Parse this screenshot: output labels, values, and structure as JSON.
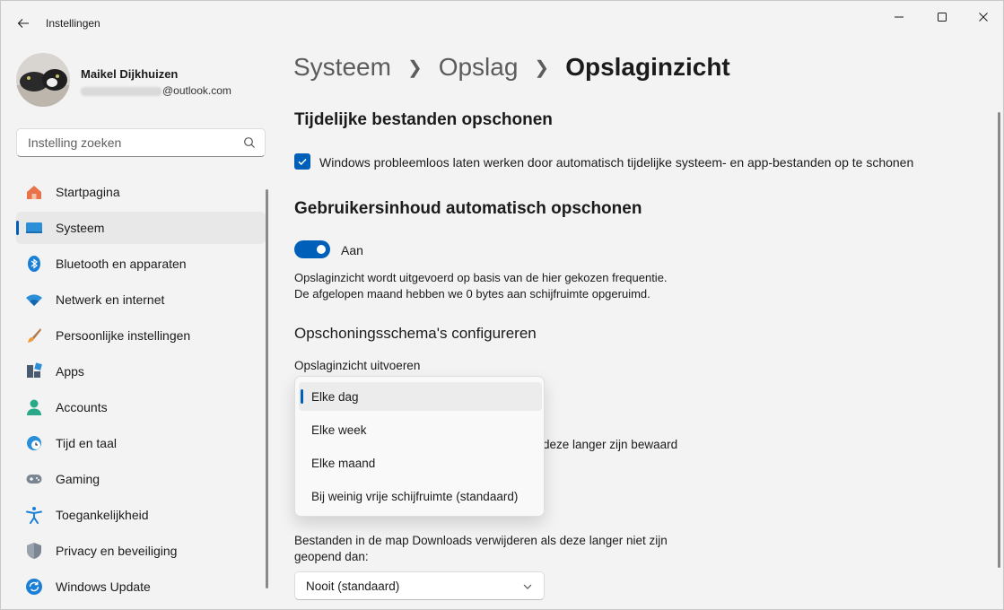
{
  "window": {
    "title": "Instellingen"
  },
  "user": {
    "name": "Maikel Dijkhuizen",
    "email_domain": "@outlook.com"
  },
  "search": {
    "placeholder": "Instelling zoeken"
  },
  "nav": {
    "items": [
      {
        "label": "Startpagina"
      },
      {
        "label": "Systeem"
      },
      {
        "label": "Bluetooth en apparaten"
      },
      {
        "label": "Netwerk en internet"
      },
      {
        "label": "Persoonlijke instellingen"
      },
      {
        "label": "Apps"
      },
      {
        "label": "Accounts"
      },
      {
        "label": "Tijd en taal"
      },
      {
        "label": "Gaming"
      },
      {
        "label": "Toegankelijkheid"
      },
      {
        "label": "Privacy en beveiliging"
      },
      {
        "label": "Windows Update"
      }
    ],
    "active": "Systeem"
  },
  "breadcrumb": {
    "level1": "Systeem",
    "level2": "Opslag",
    "current": "Opslaginzicht"
  },
  "temp_files": {
    "heading": "Tijdelijke bestanden opschonen",
    "checkbox_label": "Windows probleemloos laten werken door automatisch tijdelijke systeem- en app-bestanden op te schonen",
    "checked": true
  },
  "user_content": {
    "heading": "Gebruikersinhoud automatisch opschonen",
    "toggle_label": "Aan",
    "toggle_on": true,
    "desc_line1": "Opslaginzicht wordt uitgevoerd op basis van de hier gekozen frequentie.",
    "desc_line2": "De afgelopen maand hebben we 0 bytes aan schijfruimte opgeruimd."
  },
  "schedule": {
    "heading": "Opschoningsschema's configureren",
    "run_label": "Opslaginzicht uitvoeren",
    "run_options": [
      "Elke dag",
      "Elke week",
      "Elke maand",
      "Bij weinig vrije schijfruimte (standaard)"
    ],
    "run_selected": "Elke dag",
    "recycle_partial": "deze langer zijn bewaard",
    "downloads_label_line1": "Bestanden in de map Downloads verwijderen als deze langer niet zijn",
    "downloads_label_line2": "geopend dan:",
    "downloads_value": "Nooit (standaard)"
  },
  "colors": {
    "accent": "#005fb8",
    "background": "#f3f3f3"
  }
}
